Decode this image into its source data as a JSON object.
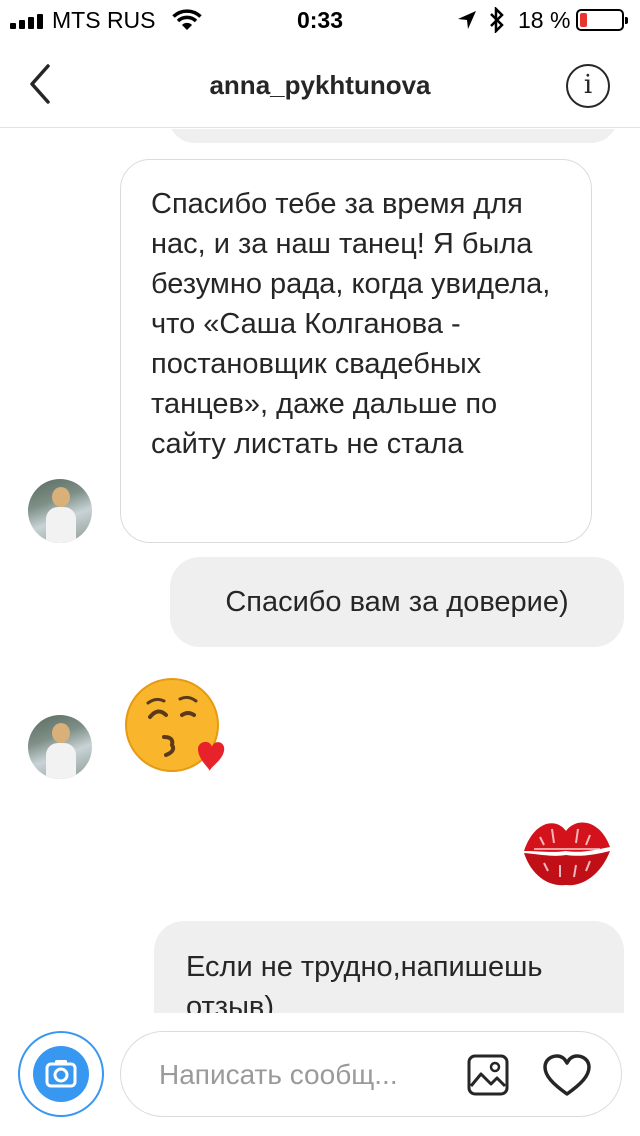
{
  "status_bar": {
    "carrier": "MTS RUS",
    "time": "0:33",
    "battery_percent": "18 %",
    "battery_level": 0.18
  },
  "header": {
    "title": "anna_pykhtunova",
    "info_label": "i"
  },
  "messages": [
    {
      "from": "contact",
      "text": "Спасибо тебе за время для нас, и за наш танец! Я была безумно рада, когда увидела, что «Саша Колганова - постановщик свадебных танцев», даже дальше по сайту листать не стала"
    },
    {
      "from": "me",
      "text": "Спасибо вам за доверие)"
    },
    {
      "from": "contact",
      "emoji": "face-throwing-kiss"
    },
    {
      "from": "me",
      "emoji": "kiss-mark-lips"
    },
    {
      "from": "me",
      "text": "Если не трудно,напишешь отзыв)"
    }
  ],
  "composer": {
    "placeholder": "Написать сообщ..."
  },
  "icons": {
    "back": "chevron-left-icon",
    "info": "info-icon",
    "camera": "camera-icon",
    "gallery": "image-icon",
    "like": "heart-icon"
  },
  "colors": {
    "accent": "#3897f0",
    "outgoing_bubble": "#efefef",
    "battery_low": "#e8352e"
  }
}
